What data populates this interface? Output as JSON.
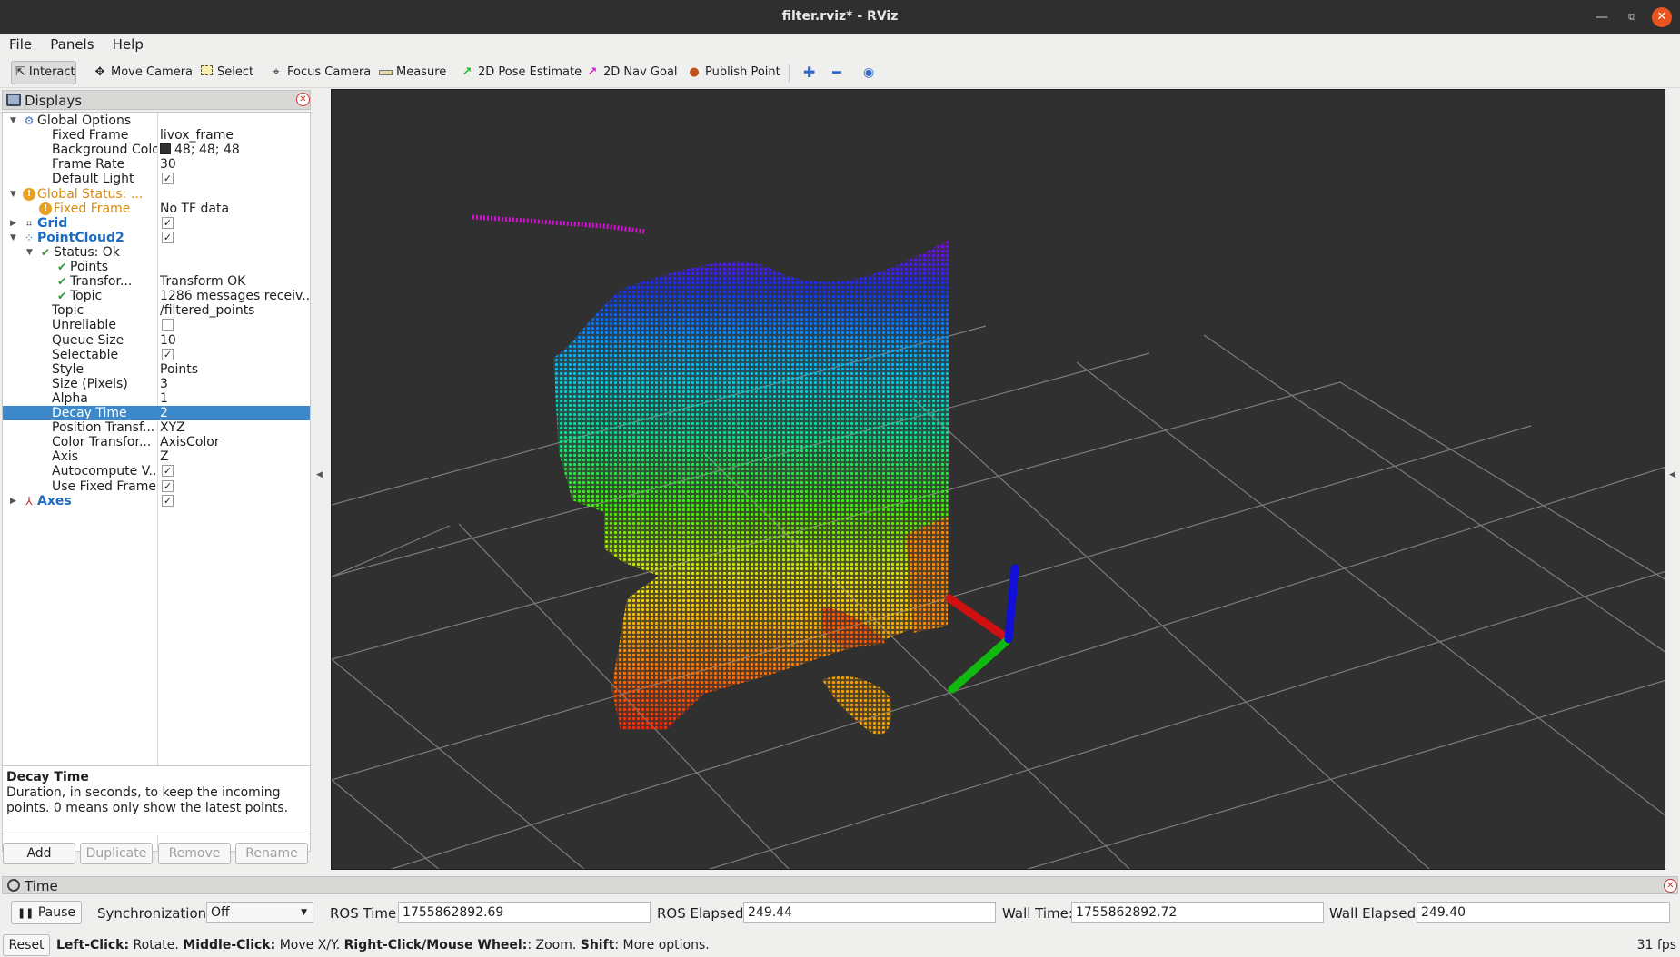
{
  "window": {
    "title": "filter.rviz* - RViz"
  },
  "menu": {
    "file": "File",
    "panels": "Panels",
    "help": "Help"
  },
  "toolbar": {
    "interact": "Interact",
    "move_camera": "Move Camera",
    "select": "Select",
    "focus_camera": "Focus Camera",
    "measure": "Measure",
    "pose_estimate": "2D Pose Estimate",
    "nav_goal": "2D Nav Goal",
    "publish_point": "Publish Point"
  },
  "displays": {
    "title": "Displays",
    "rows": [
      {
        "key": "Global Options",
        "value": "",
        "depth": 0,
        "expanded": true,
        "icon": "gear"
      },
      {
        "key": "Fixed Frame",
        "value": "livox_frame",
        "depth": 1
      },
      {
        "key": "Background Color",
        "value": "48; 48; 48",
        "depth": 1,
        "swatch": "#303030"
      },
      {
        "key": "Frame Rate",
        "value": "30",
        "depth": 1
      },
      {
        "key": "Default Light",
        "value": "",
        "depth": 1,
        "checkbox": true
      },
      {
        "key": "Global Status: ...",
        "value": "",
        "depth": 0,
        "expanded": true,
        "icon": "warn",
        "style": "orange"
      },
      {
        "key": "Fixed Frame",
        "value": "No TF data",
        "depth": 1,
        "icon": "warn",
        "style": "orange"
      },
      {
        "key": "Grid",
        "value": "",
        "depth": 0,
        "expanded": false,
        "icon": "grid",
        "style": "blue",
        "checkbox": true
      },
      {
        "key": "PointCloud2",
        "value": "",
        "depth": 0,
        "expanded": true,
        "icon": "cloud",
        "style": "blue",
        "checkbox": true
      },
      {
        "key": "Status: Ok",
        "value": "",
        "depth": 1,
        "expanded": true,
        "icon": "check"
      },
      {
        "key": "Points",
        "value": "",
        "depth": 2,
        "icon": "check"
      },
      {
        "key": "Transfor...",
        "value": "Transform OK",
        "depth": 2,
        "icon": "check"
      },
      {
        "key": "Topic",
        "value": "1286 messages receiv...",
        "depth": 2,
        "icon": "check"
      },
      {
        "key": "Topic",
        "value": "/filtered_points",
        "depth": 1
      },
      {
        "key": "Unreliable",
        "value": "",
        "depth": 1,
        "checkbox": false
      },
      {
        "key": "Queue Size",
        "value": "10",
        "depth": 1
      },
      {
        "key": "Selectable",
        "value": "",
        "depth": 1,
        "checkbox": true
      },
      {
        "key": "Style",
        "value": "Points",
        "depth": 1
      },
      {
        "key": "Size (Pixels)",
        "value": "3",
        "depth": 1
      },
      {
        "key": "Alpha",
        "value": "1",
        "depth": 1
      },
      {
        "key": "Decay Time",
        "value": "2",
        "depth": 1,
        "selected": true
      },
      {
        "key": "Position Transf...",
        "value": "XYZ",
        "depth": 1
      },
      {
        "key": "Color Transfor...",
        "value": "AxisColor",
        "depth": 1
      },
      {
        "key": "Axis",
        "value": "Z",
        "depth": 1
      },
      {
        "key": "Autocompute V...",
        "value": "",
        "depth": 1,
        "checkbox": true
      },
      {
        "key": "Use Fixed Frame",
        "value": "",
        "depth": 1,
        "checkbox": true
      },
      {
        "key": "Axes",
        "value": "",
        "depth": 0,
        "expanded": false,
        "icon": "axes",
        "style": "blue",
        "checkbox": true
      }
    ],
    "description": {
      "title": "Decay Time",
      "text": "Duration, in seconds, to keep the incoming points. 0 means only show the latest points."
    },
    "buttons": {
      "add": "Add",
      "duplicate": "Duplicate",
      "remove": "Remove",
      "rename": "Rename"
    }
  },
  "time": {
    "title": "Time",
    "pause": "Pause",
    "sync_label": "Synchronization:",
    "sync_value": "Off",
    "ros_time_label": "ROS Time:",
    "ros_time": "1755862892.69",
    "ros_elapsed_label": "ROS Elapsed:",
    "ros_elapsed": "249.44",
    "wall_time_label": "Wall Time:",
    "wall_time": "1755862892.72",
    "wall_elapsed_label": "Wall Elapsed:",
    "wall_elapsed": "249.40"
  },
  "status": {
    "reset": "Reset",
    "left": "Left-Click:",
    "left_txt": " Rotate. ",
    "middle": "Middle-Click:",
    "middle_txt": " Move X/Y. ",
    "right": "Right-Click/Mouse Wheel:",
    "right_txt": ": Zoom. ",
    "shift": "Shift",
    "shift_txt": ": More options.",
    "fps": "31 fps"
  }
}
